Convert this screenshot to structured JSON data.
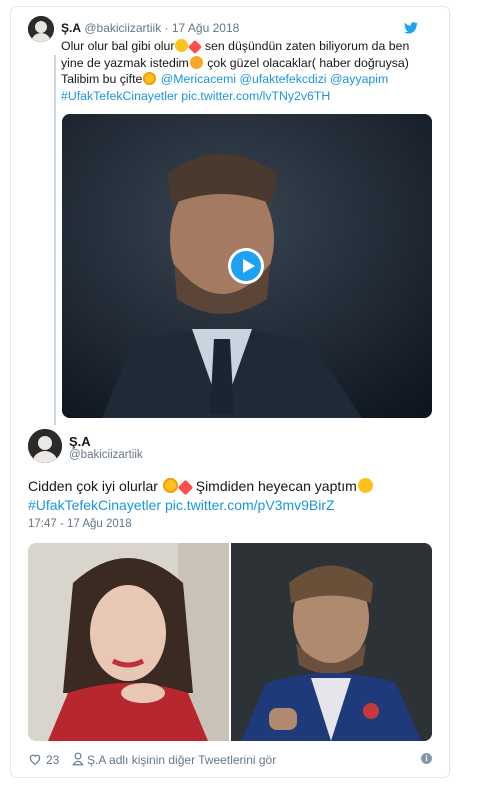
{
  "parent_tweet": {
    "name": "Ş.A",
    "handle_date": "@bakiciizartiik · 17 Ağu 2018",
    "text_1": "Olur olur bal gibi olur",
    "text_2": " sen düşündün zaten biliyorum da ben yine de yazmak istedim",
    "text_3": " çok güzel olacaklar( haber doğruysa) Talibim bu çifte",
    "mention_1": "@Mericacemi",
    "mention_2": "@ufaktefekcdizi",
    "mention_3": "@ayyapim",
    "hashtag": "#UfakTefekCinayetler",
    "pic_link": "pic.twitter.com/lvTNy2v6TH"
  },
  "main_tweet": {
    "name": "Ş.A",
    "handle": "@bakiciizartiik",
    "text_1": "Cidden çok iyi olurlar ",
    "text_2": " Şimdiden heyecan yaptım",
    "hashtag": "#UfakTefekCinayetler",
    "pic_link": "pic.twitter.com/pV3mv9BirZ",
    "timestamp": "17:47 - 17 Ağu 2018"
  },
  "footer": {
    "likes": "23",
    "more_tweets": "Ş.A adlı kişinin diğer Tweetlerini gör",
    "info_glyph": "i"
  },
  "icons": {
    "twitter_brand": "#1da1f2",
    "link_color": "#1b95e0",
    "muted_text": "#657786"
  }
}
